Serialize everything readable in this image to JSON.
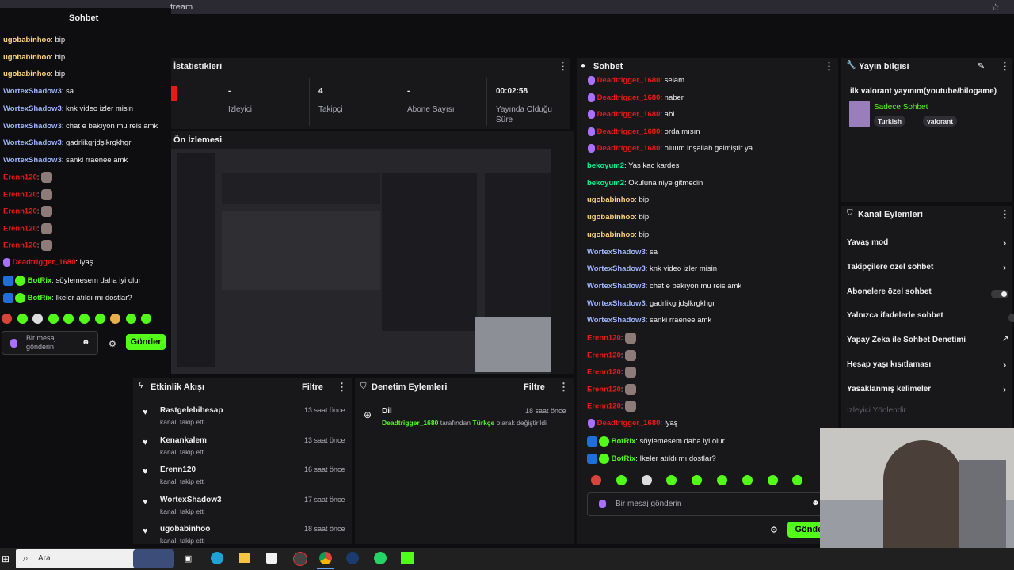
{
  "browser": {
    "url_fragment": "tream",
    "star": "☆"
  },
  "popout_chat": {
    "title": "Sohbet",
    "lines": [
      {
        "user": "ugobabinhoo",
        "color": "#ffd37a",
        "msg": "bip"
      },
      {
        "user": "ugobabinhoo",
        "color": "#ffd37a",
        "msg": "bip"
      },
      {
        "user": "ugobabinhoo",
        "color": "#ffd37a",
        "msg": "bip"
      },
      {
        "user": "WortexShadow3",
        "color": "#9fb5ff",
        "msg": "sa"
      },
      {
        "user": "WortexShadow3",
        "color": "#9fb5ff",
        "msg": "knk video izler misin"
      },
      {
        "user": "WortexShadow3",
        "color": "#9fb5ff",
        "msg": "chat e bakıyon mu reis amk"
      },
      {
        "user": "WortexShadow3",
        "color": "#9fb5ff",
        "msg": "gadrlikgrjdşlkrgkhgr"
      },
      {
        "user": "WortexShadow3",
        "color": "#9fb5ff",
        "msg": "sanki rraenee amk"
      }
    ],
    "erenn_user": "Erenn120",
    "dead_user": "Deadtrigger_1680",
    "dead_msg": "lyaş",
    "botrix_user": "BotRix",
    "botrix_msg1": "söylemesem daha iyi olur",
    "botrix_msg2": "Ikeler atıldı mı dostlar?",
    "input_placeholder": "Bir mesaj gönderin",
    "send": "Gönder"
  },
  "stats": {
    "title": "İstatistikleri",
    "items": [
      {
        "value": "-",
        "label": "İzleyici"
      },
      {
        "value": "4",
        "label": "Takipçi"
      },
      {
        "value": "-",
        "label": "Abone Sayısı"
      },
      {
        "value": "00:02:58",
        "label": "Yayında Olduğu Süre"
      }
    ]
  },
  "preview": {
    "title": "Ön İzlemesi"
  },
  "activity": {
    "title": "Etkinlik Akışı",
    "filter": "Filtre",
    "items": [
      {
        "name": "Rastgelebihesap",
        "sub": "kanalı takip etti",
        "time": "13 saat önce"
      },
      {
        "name": "Kenankalem",
        "sub": "kanalı takip etti",
        "time": "13 saat önce"
      },
      {
        "name": "Erenn120",
        "sub": "kanalı takip etti",
        "time": "16 saat önce"
      },
      {
        "name": "WortexShadow3",
        "sub": "kanalı takip etti",
        "time": "17 saat önce"
      },
      {
        "name": "ugobabinhoo",
        "sub": "kanalı takip etti",
        "time": "18 saat önce"
      }
    ]
  },
  "moderation": {
    "title": "Denetim Eylemleri",
    "filter": "Filtre",
    "item": {
      "title": "Dil",
      "user": "Deadtrigger_1680",
      "mid": "tarafından",
      "lang": "Türkçe",
      "end": "olarak değiştirildi",
      "time": "18 saat önce"
    }
  },
  "chat": {
    "title": "Sohbet",
    "dead_lines": [
      {
        "user": "Deadtrigger_1680",
        "msg": "selam"
      },
      {
        "user": "Deadtrigger_1680",
        "msg": "naber"
      },
      {
        "user": "Deadtrigger_1680",
        "msg": "abi"
      },
      {
        "user": "Deadtrigger_1680",
        "msg": "orda mısın"
      },
      {
        "user": "Deadtrigger_1680",
        "msg": "oluum inşallah gelmiştir ya"
      }
    ],
    "lines": [
      {
        "user": "bekoyum2",
        "color": "#00f593",
        "msg": "Yas kac kardes"
      },
      {
        "user": "bekoyum2",
        "color": "#00f593",
        "msg": "Okuluna niye gitmedin"
      },
      {
        "user": "ugobabinhoo",
        "color": "#ffd37a",
        "msg": "bip"
      },
      {
        "user": "ugobabinhoo",
        "color": "#ffd37a",
        "msg": "bip"
      },
      {
        "user": "ugobabinhoo",
        "color": "#ffd37a",
        "msg": "bip"
      },
      {
        "user": "WortexShadow3",
        "color": "#9fb5ff",
        "msg": "sa"
      },
      {
        "user": "WortexShadow3",
        "color": "#9fb5ff",
        "msg": "knk video izler misin"
      },
      {
        "user": "WortexShadow3",
        "color": "#9fb5ff",
        "msg": "chat e bakıyon mu reis amk"
      },
      {
        "user": "WortexShadow3",
        "color": "#9fb5ff",
        "msg": "gadrlikgrjdşlkrgkhgr"
      },
      {
        "user": "WortexShadow3",
        "color": "#9fb5ff",
        "msg": "sanki rraenee amk"
      }
    ],
    "erenn_user": "Erenn120",
    "dead_user": "Deadtrigger_1680",
    "dead_msg": "lyaş",
    "botrix_user": "BotRix",
    "botrix_msg1": "söylemesem daha iyi olur",
    "botrix_msg2": "Ikeler atıldı mı dostlar?",
    "input_placeholder": "Bir mesaj gönderin",
    "send": "Gönder"
  },
  "stream_info": {
    "title": "Yayın bilgisi",
    "stream_title": "ilk valorant yayınım(youtube/bilogame)",
    "category": "Sadece Sohbet",
    "tags": [
      "Turkish",
      "valorant"
    ]
  },
  "channel_actions": {
    "title": "Kanal Eylemleri",
    "items": [
      {
        "label": "Yavaş mod",
        "ctrl": "chevron"
      },
      {
        "label": "Takipçilere özel sohbet",
        "ctrl": "chevron"
      },
      {
        "label": "Abonelere özel sohbet",
        "ctrl": "toggle"
      },
      {
        "label": "Yalnızca ifadelerle sohbet",
        "ctrl": "toggle"
      },
      {
        "label": "Yapay Zeka ile Sohbet Denetimi",
        "ctrl": "external"
      },
      {
        "label": "Hesap yaşı kısıtlaması",
        "ctrl": "chevron"
      },
      {
        "label": "Yasaklanmış kelimeler",
        "ctrl": "chevron"
      }
    ],
    "disabled_item": "İzleyici Yönlendir"
  },
  "taskbar": {
    "search": "Ara"
  }
}
